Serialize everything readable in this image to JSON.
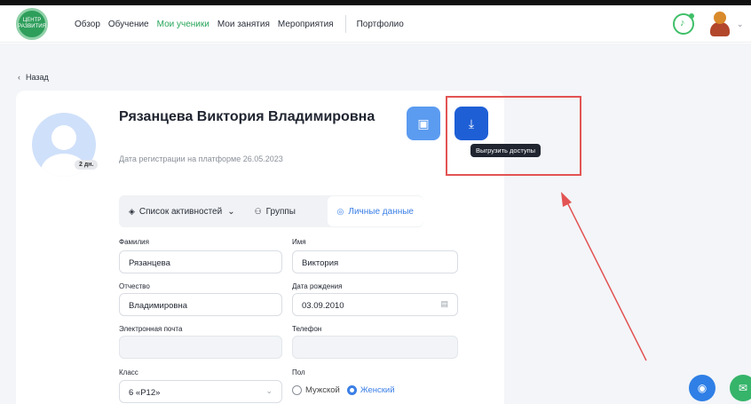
{
  "header": {
    "logo_text": "ЦЕНТР РАЗВИТИЯ",
    "nav": [
      "Обзор",
      "Обучение",
      "Мои ученики",
      "Мои занятия",
      "Мероприятия"
    ],
    "nav_extra": "Портфолио",
    "active_nav": "Мои ученики",
    "accent": "#27a55a"
  },
  "back_label": "Назад",
  "profile": {
    "full_name": "Рязанцева Виктория Владимировна",
    "age_badge": "2 дн.",
    "registration": "Дата регистрации на платформе 26.05.2023"
  },
  "actions": {
    "archive_icon": "archive-icon",
    "download_icon": "download-icon",
    "download_tooltip": "Выгрузить доступы"
  },
  "tabs": {
    "activities": "Список активностей",
    "groups": "Группы",
    "personal": "Личные данные"
  },
  "form": {
    "surname_label": "Фамилия",
    "surname_value": "Рязанцева",
    "name_label": "Имя",
    "name_value": "Виктория",
    "patronymic_label": "Отчество",
    "patronymic_value": "Владимировна",
    "birthdate_label": "Дата рождения",
    "birthdate_value": "03.09.2010",
    "email_label": "Электронная почта",
    "email_value": "",
    "phone_label": "Телефон",
    "phone_value": "",
    "class_label": "Класс",
    "class_value": "6 «Р12»",
    "gender_label": "Пол",
    "gender_male": "Мужской",
    "gender_female": "Женский",
    "gender_selected": "Женский"
  },
  "colors": {
    "primary_blue": "#1e5fd6",
    "light_blue": "#5b9bf0",
    "annotation_red": "#e35353"
  }
}
